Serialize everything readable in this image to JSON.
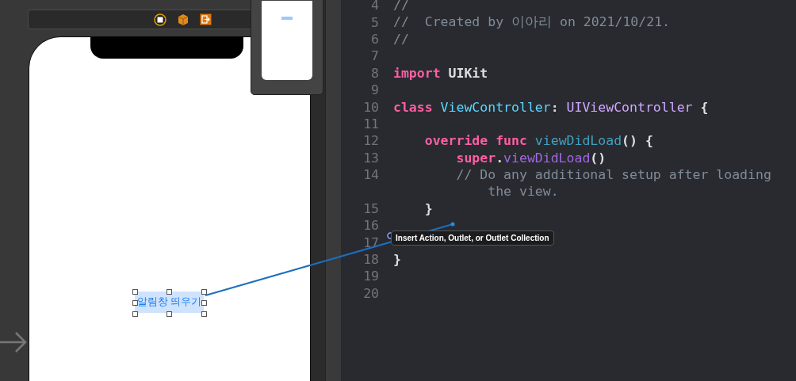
{
  "canvas": {
    "button": {
      "label": "알림창 띄우기",
      "selected": true
    }
  },
  "editor": {
    "lines": [
      {
        "number": "4",
        "tokens": [
          {
            "kind": "comment",
            "text": "//"
          }
        ]
      },
      {
        "number": "5",
        "tokens": [
          {
            "kind": "comment",
            "text": "//  Created by 이아리 on 2021/10/21."
          }
        ]
      },
      {
        "number": "6",
        "tokens": [
          {
            "kind": "comment",
            "text": "//"
          }
        ]
      },
      {
        "number": "7"
      },
      {
        "number": "8",
        "tokens": [
          {
            "kind": "keyword",
            "text": "import"
          },
          {
            "kind": "plain",
            "text": " UIKit"
          }
        ]
      },
      {
        "number": "9"
      },
      {
        "number": "10",
        "tokens": [
          {
            "kind": "keyword",
            "text": "class"
          },
          {
            "kind": "type_decl",
            "text": " ViewController"
          },
          {
            "kind": "plain",
            "text": ": "
          },
          {
            "kind": "type_ref",
            "text": "UIViewController"
          },
          {
            "kind": "plain",
            "text": " {"
          }
        ]
      },
      {
        "number": "11"
      },
      {
        "number": "12",
        "tokens": [
          {
            "kind": "keyword",
            "text": "    override func"
          },
          {
            "kind": "func_decl",
            "text": " viewDidLoad"
          },
          {
            "kind": "plain",
            "text": "() {"
          }
        ]
      },
      {
        "number": "13",
        "tokens": [
          {
            "kind": "keyword",
            "text": "        super"
          },
          {
            "kind": "plain",
            "text": "."
          },
          {
            "kind": "method",
            "text": "viewDidLoad"
          },
          {
            "kind": "plain",
            "text": "()"
          }
        ]
      },
      {
        "number": "14",
        "tokens": [
          {
            "kind": "comment",
            "text": "        // Do any additional setup after loading"
          }
        ],
        "continuation": [
          {
            "kind": "comment",
            "text": "            the view."
          }
        ]
      },
      {
        "number": "15",
        "tokens": [
          {
            "kind": "plain",
            "text": "    }"
          }
        ]
      },
      {
        "number": "16"
      },
      {
        "number": "17"
      },
      {
        "number": "18",
        "tokens": [
          {
            "kind": "plain",
            "text": "}"
          }
        ]
      },
      {
        "number": "19"
      },
      {
        "number": "20"
      }
    ]
  },
  "tooltip": {
    "text": "Insert Action, Outlet, or Outlet Collection"
  }
}
